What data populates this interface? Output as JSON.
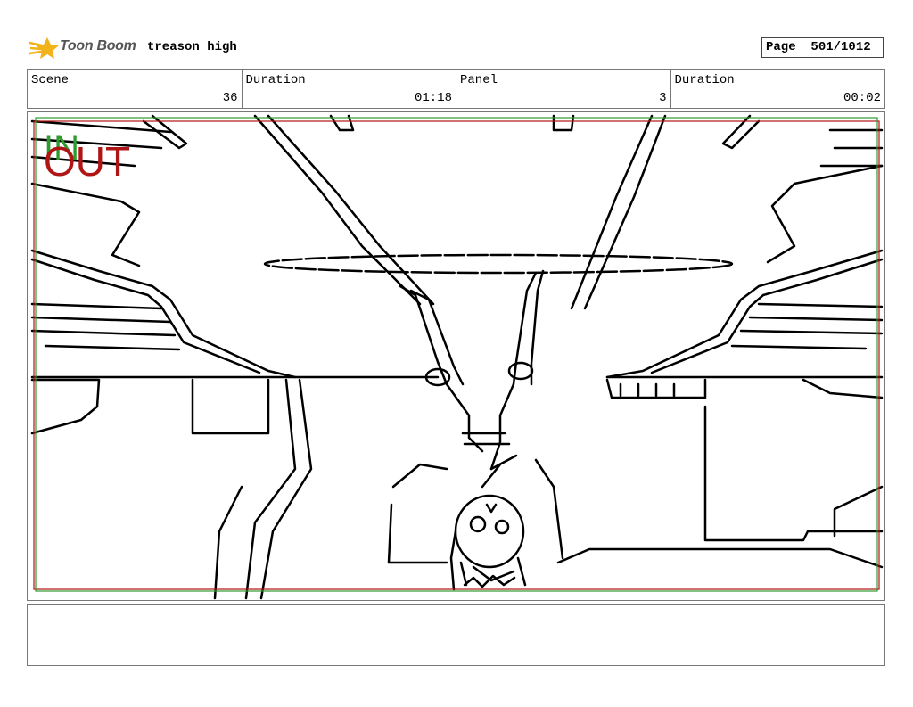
{
  "header": {
    "logo_text": "Toon Boom",
    "project_title": "treason high",
    "page_label": "Page",
    "page_value": "501/1012"
  },
  "info": {
    "scene_label": "Scene",
    "scene_value": "36",
    "duration_label": "Duration",
    "duration_value": "01:18",
    "panel_label": "Panel",
    "panel_value": "3",
    "panel_duration_label": "Duration",
    "panel_duration_value": "00:02"
  },
  "panel_marks": {
    "in_text": "IN",
    "out_text": "OUT",
    "in_color": "#2e9b2e",
    "out_color": "#b01515"
  },
  "colors": {
    "logo_star": "#f2b21b",
    "frame_border": "#777777"
  },
  "notes": {
    "text": ""
  }
}
